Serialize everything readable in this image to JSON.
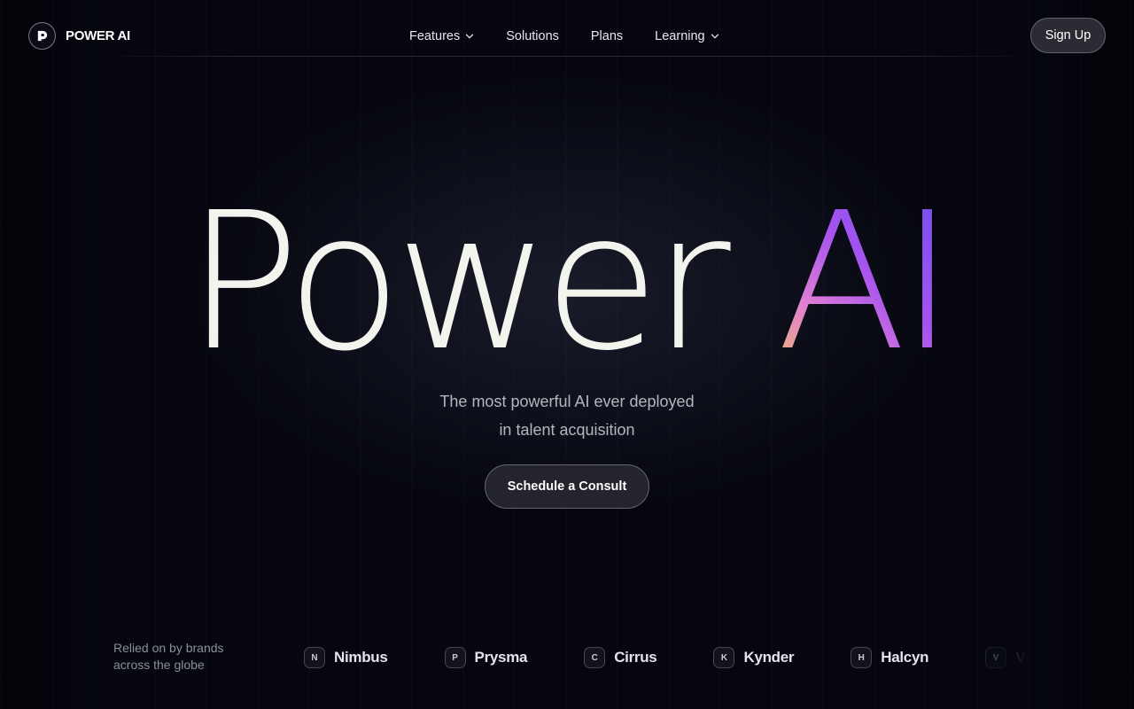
{
  "header": {
    "logo_text": "POWER AI",
    "nav": [
      {
        "label": "Features",
        "has_dropdown": true
      },
      {
        "label": "Solutions",
        "has_dropdown": false
      },
      {
        "label": "Plans",
        "has_dropdown": false
      },
      {
        "label": "Learning",
        "has_dropdown": true
      }
    ],
    "signup_label": "Sign Up"
  },
  "hero": {
    "title_word1": "Power",
    "title_word2": "AI",
    "subtitle_line1": "The most powerful AI ever deployed",
    "subtitle_line2": "in talent acquisition",
    "cta_label": "Schedule a Consult"
  },
  "brands": {
    "label_line1": "Relied on by brands",
    "label_line2": "across the globe",
    "items": [
      {
        "initial": "N",
        "name": "Nimbus"
      },
      {
        "initial": "P",
        "name": "Prysma"
      },
      {
        "initial": "C",
        "name": "Cirrus"
      },
      {
        "initial": "K",
        "name": "Kynder"
      },
      {
        "initial": "H",
        "name": "Halcyn"
      },
      {
        "initial": "V",
        "name": "Vo"
      }
    ]
  },
  "colors": {
    "background": "#05060f",
    "gradient_start": "#f2c45a",
    "gradient_mid": "#a553ef",
    "gradient_end": "#6b4ff0"
  }
}
